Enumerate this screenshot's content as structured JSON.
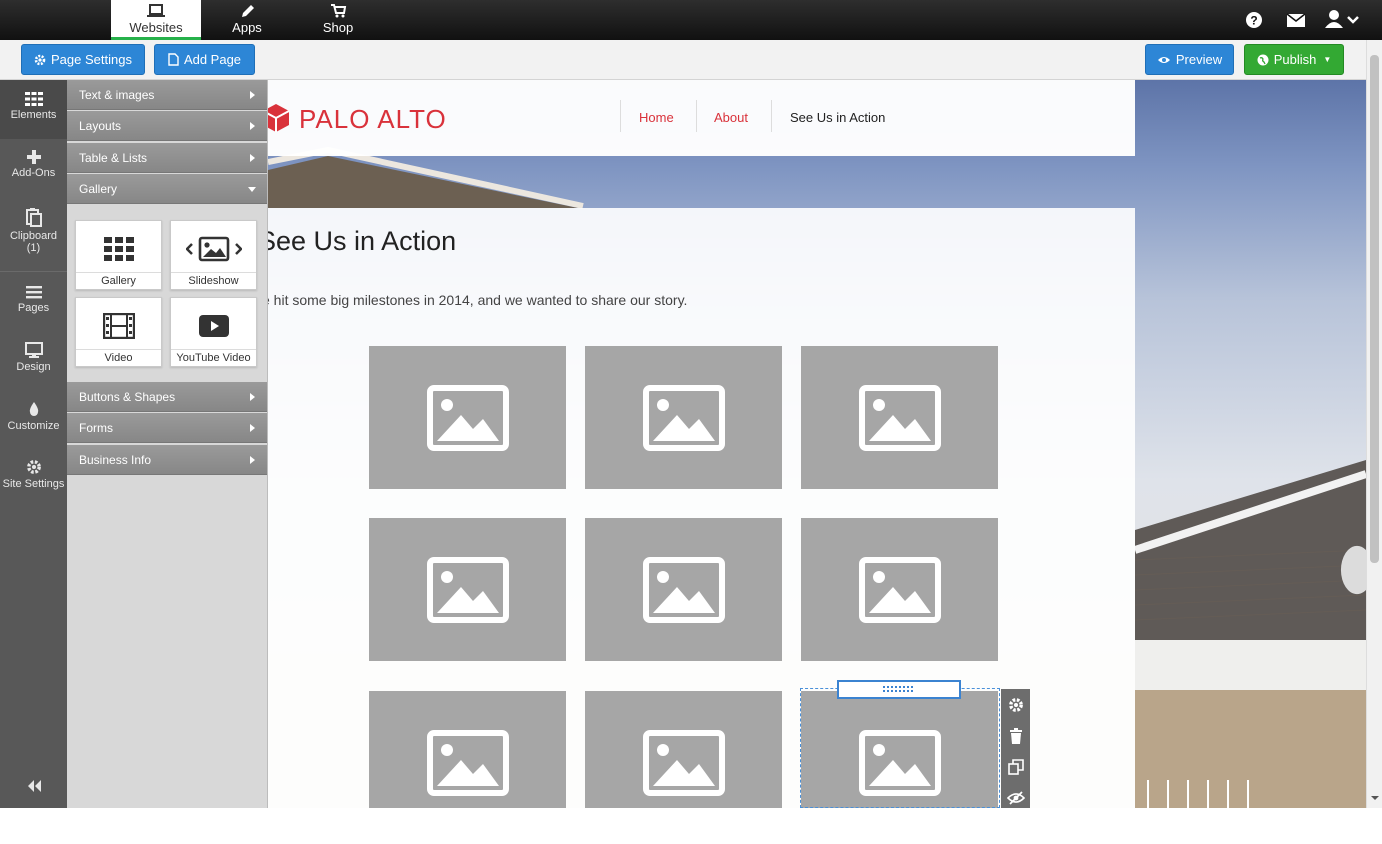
{
  "topnav": {
    "items": [
      {
        "label": "Websites",
        "icon": "laptop-icon",
        "active": true
      },
      {
        "label": "Apps",
        "icon": "pencil-icon"
      },
      {
        "label": "Shop",
        "icon": "cart-icon"
      }
    ],
    "right_icons": [
      "help-icon",
      "mail-icon",
      "user-icon",
      "chevron-down-icon"
    ]
  },
  "toolbar": {
    "page_settings_label": "Page Settings",
    "add_page_label": "Add Page",
    "preview_label": "Preview",
    "publish_label": "Publish"
  },
  "rail": {
    "items": [
      {
        "label": "Elements",
        "icon": "grid-icon"
      },
      {
        "label": "Add-Ons",
        "icon": "plus-icon"
      },
      {
        "label": "Clipboard",
        "count": "(1)",
        "icon": "clipboard-icon"
      },
      {
        "label": "Pages",
        "icon": "pages-icon"
      },
      {
        "label": "Design",
        "icon": "monitor-icon"
      },
      {
        "label": "Customize",
        "icon": "drop-icon"
      },
      {
        "label": "Site Settings",
        "icon": "gear-icon"
      }
    ],
    "collapse_icon": "double-chevron-left-icon"
  },
  "panel": {
    "categories": [
      {
        "label": "Text & images"
      },
      {
        "label": "Layouts"
      },
      {
        "label": "Table & Lists"
      },
      {
        "label": "Gallery",
        "expanded": true
      },
      {
        "label": "Buttons & Shapes"
      },
      {
        "label": "Forms"
      },
      {
        "label": "Business Info"
      }
    ],
    "gallery_items": [
      {
        "label": "Gallery",
        "icon": "grid-icon"
      },
      {
        "label": "Slideshow",
        "icon": "slideshow-icon"
      },
      {
        "label": "Video",
        "icon": "film-icon"
      },
      {
        "label": "YouTube Video",
        "icon": "play-icon"
      }
    ]
  },
  "site": {
    "logo_text": "PALO ALTO",
    "nav": [
      "Home",
      "About",
      "See Us in Action"
    ],
    "nav_active": "See Us in Action",
    "page_title": "See Us in Action",
    "intro": "e hit some big milestones in 2014, and we wanted to share our story."
  },
  "colors": {
    "accent_blue": "#2d86d6",
    "publish_green": "#33a933",
    "brand_red": "#d9323b",
    "active_tab_border": "#26b14a"
  }
}
